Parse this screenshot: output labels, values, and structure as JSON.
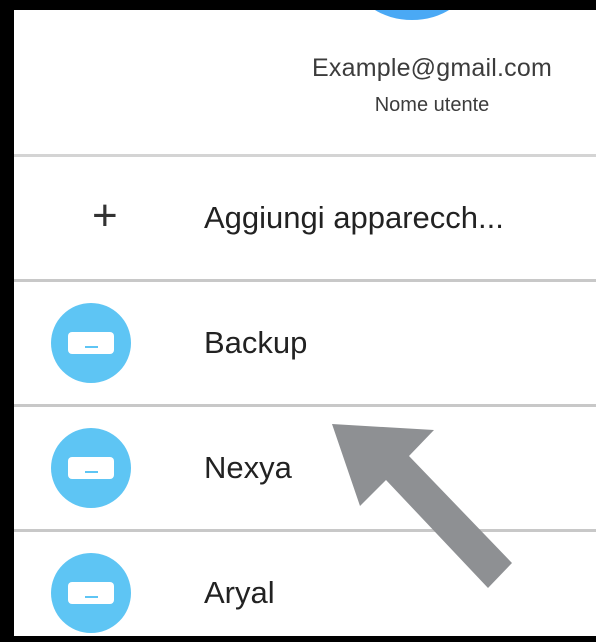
{
  "account": {
    "email": "Example@gmail.com",
    "username": "Nome utente"
  },
  "actions": {
    "add_device_label": "Aggiungi apparecch...",
    "add_icon": "+"
  },
  "devices": [
    {
      "name": "Backup",
      "icon": "air-conditioner-icon"
    },
    {
      "name": "Nexya",
      "icon": "air-conditioner-icon"
    },
    {
      "name": "Aryal",
      "icon": "air-conditioner-icon"
    }
  ],
  "colors": {
    "avatar": "#4aa9f5",
    "device_icon": "#5ec5f4",
    "arrow": "#8e9093",
    "divider": "#c8c8c8"
  }
}
